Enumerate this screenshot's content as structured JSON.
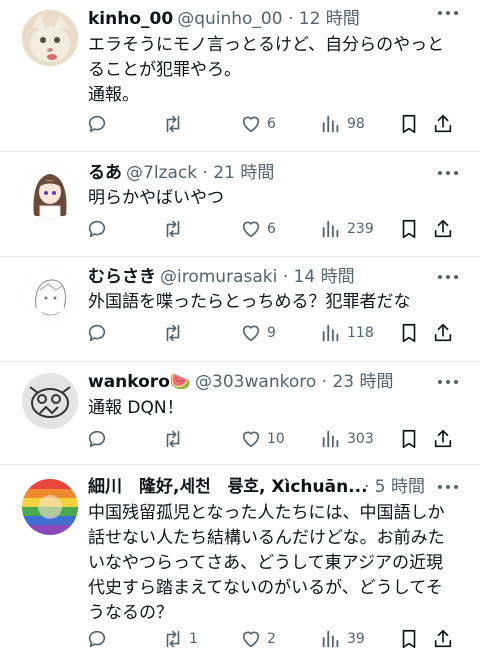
{
  "colors": {
    "text": "#0f1419",
    "secondary": "#536471",
    "divider": "#e5e8eb"
  },
  "tweets": [
    {
      "name": "kinho_00",
      "handle_time": "@quinho_00 · 12 時間",
      "lines": [
        "エラそうにモノ言っとるけど、自分らのやっと",
        "ることが犯罪やろ。",
        "通報。"
      ],
      "replies": "",
      "retweets": "",
      "likes": "6",
      "views": "98"
    },
    {
      "name": "るあ",
      "handle_time": "@7lzack · 21 時間",
      "lines": [
        "明らかやばいやつ"
      ],
      "replies": "",
      "retweets": "",
      "likes": "6",
      "views": "239"
    },
    {
      "name": "むらさき",
      "handle_time": "@iromurasaki · 14 時間",
      "lines": [
        "外国語を喋ったらとっちめる？犯罪者だな"
      ],
      "replies": "",
      "retweets": "",
      "likes": "9",
      "views": "118"
    },
    {
      "name": "wankoro🍉",
      "handle_time": "@303wankoro · 23 時間",
      "lines": [
        "通報 DQN！"
      ],
      "replies": "",
      "retweets": "",
      "likes": "10",
      "views": "303"
    },
    {
      "name": "細川　隆好,세천　륭호, Xìchuān...",
      "handle_time": "· 5 時間",
      "lines": [
        "中国残留孤児となった人たちには、中国語しか",
        "話せない人たち結構いるんだけどな。お前みた",
        "いなやつらってさあ、どうして東アジアの近現",
        "代史すら踏まえてないのがいるが、どうしてそ",
        "うなるの？"
      ],
      "replies": "",
      "retweets": "1",
      "likes": "2",
      "views": "39"
    }
  ]
}
